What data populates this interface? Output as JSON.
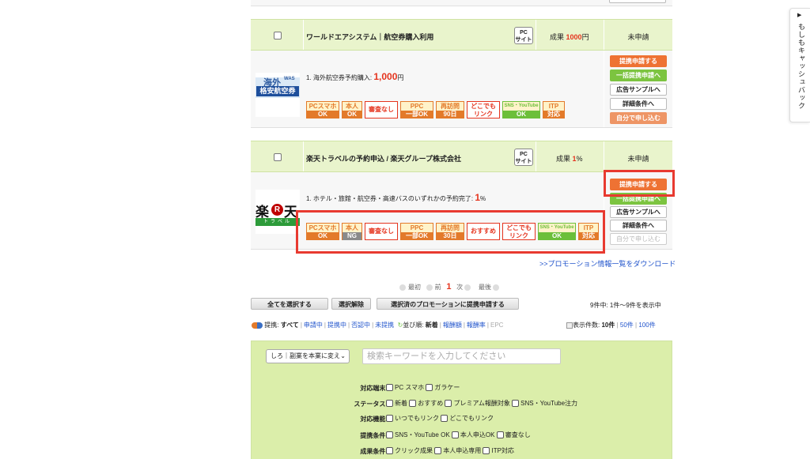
{
  "programs": [
    {
      "name": "ワールドエアシステム｜航空券購入利用",
      "pc_badge": [
        "PC",
        "サイト"
      ],
      "reward_prefix": "成果",
      "reward_value": "1000",
      "reward_suffix": "円",
      "status": "未申請",
      "goal_text": "1. 海外航空券予約購入:",
      "goal_value": "1,000",
      "goal_unit": "円",
      "banner": [
        "海外",
        "WAS",
        "格安航空券"
      ],
      "tags": [
        {
          "top": "PCスマホ",
          "bot": "OK"
        },
        {
          "top": "本人",
          "bot": "OK"
        },
        {
          "single": "審査なし"
        },
        {
          "top": "PPC",
          "bot": "一部OK"
        },
        {
          "top": "再訪問",
          "bot": "90日"
        },
        {
          "double": [
            "どこでも",
            "リンク"
          ]
        },
        {
          "top": "SNS・YouTube",
          "bot": "OK"
        },
        {
          "top": "ITP",
          "bot": "対応"
        }
      ],
      "buttons": [
        "提携申請する",
        "一括提携申請へ",
        "広告サンプルへ",
        "詳細条件へ",
        "自分で申し込む"
      ]
    },
    {
      "name": "楽天トラベルの予約申込 / 楽天グループ株式会社",
      "pc_badge": [
        "PC",
        "サイト"
      ],
      "reward_prefix": "成果",
      "reward_value": "1",
      "reward_suffix": "%",
      "status": "未申請",
      "goal_text": "1. ホテル・旅館・航空券・高速バスのいずれかの予約完了:",
      "goal_value": "1",
      "goal_unit": "%",
      "banner": [
        "楽",
        "R",
        "天",
        "トラベル"
      ],
      "tags": [
        {
          "top": "PCスマホ",
          "bot": "OK"
        },
        {
          "top": "本人",
          "bot": "NG"
        },
        {
          "single": "審査なし"
        },
        {
          "top": "PPC",
          "bot": "一部OK"
        },
        {
          "top": "再訪問",
          "bot": "30日"
        },
        {
          "single": "おすすめ"
        },
        {
          "double": [
            "どこでも",
            "リンク"
          ]
        },
        {
          "top": "SNS・YouTube",
          "bot": "OK"
        },
        {
          "top": "ITP",
          "bot": "対応"
        }
      ],
      "buttons": [
        "提携申請する",
        "一括提携申請へ",
        "広告サンプルへ",
        "詳細条件へ",
        "自分で申し込む"
      ]
    }
  ],
  "download_link": ">>プロモーション情報一覧をダウンロード",
  "pager": {
    "first": "最初",
    "prev": "前",
    "current": "1",
    "next": "次",
    "last": "最後"
  },
  "actions": {
    "select_all": "全てを選択する",
    "deselect": "選択解除",
    "apply_selected": "選択済のプロモーションに提携申請する"
  },
  "count_text": "9件中: 1件～9件を表示中",
  "filter": {
    "label_partner": "提携:",
    "all": "すべて",
    "applying": "申請中",
    "partnered": "提携中",
    "denied": "否認中",
    "not_partnered": "未提携",
    "sort_label": "並び順:",
    "new": "新着",
    "reward_amount": "報酬額",
    "reward_rate": "報酬率",
    "epc": "EPC"
  },
  "page_size": {
    "label": "表示件数:",
    "ten": "10件",
    "fifty": "50件",
    "hundred": "100件"
  },
  "search": {
    "select_value": "しろ｜副業を本業に変え",
    "keyword_placeholder": "検索キーワードを入力してください",
    "conditions": [
      {
        "label": "対応端末:",
        "options": [
          "PC スマホ",
          "ガラケー"
        ]
      },
      {
        "label": "ステータス:",
        "options": [
          "新着",
          "おすすめ",
          "プレミアム報酬対象",
          "SNS・YouTube注力"
        ]
      },
      {
        "label": "対応機能:",
        "options": [
          "いつでもリンク",
          "どこでもリンク"
        ]
      },
      {
        "label": "提携条件:",
        "options": [
          "SNS・YouTube OK",
          "本人申込OK",
          "審査なし"
        ]
      },
      {
        "label": "成果条件:",
        "options": [
          "クリック成果",
          "本人申込専用",
          "ITP対応"
        ]
      }
    ]
  },
  "side_tab": "もしもキャッシュバック",
  "colors": {
    "accent_red": "#e5341e",
    "header_green": "#e9f4cc",
    "panel_green": "#dbeeaa",
    "button_orange": "#ee7233",
    "highlight_box": "#e83a30"
  }
}
